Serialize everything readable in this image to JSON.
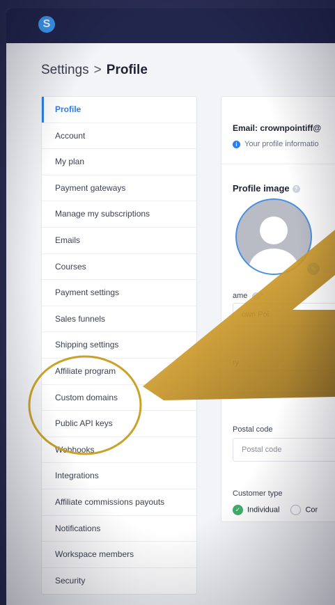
{
  "app": {
    "logo_letter": "S"
  },
  "breadcrumb": {
    "root": "Settings",
    "separator": ">",
    "current": "Profile"
  },
  "sidebar": {
    "items": [
      {
        "label": "Profile",
        "active": true
      },
      {
        "label": "Account"
      },
      {
        "label": "My plan"
      },
      {
        "label": "Payment gateways"
      },
      {
        "label": "Manage my subscriptions"
      },
      {
        "label": "Emails"
      },
      {
        "label": "Courses"
      },
      {
        "label": "Payment settings"
      },
      {
        "label": "Sales funnels"
      },
      {
        "label": "Shipping settings"
      },
      {
        "label": "Affiliate program"
      },
      {
        "label": "Custom domains"
      },
      {
        "label": "Public API keys"
      },
      {
        "label": "Webhooks"
      },
      {
        "label": "Integrations"
      },
      {
        "label": "Affiliate commissions payouts"
      },
      {
        "label": "Notifications"
      },
      {
        "label": "Workspace members"
      },
      {
        "label": "Security"
      }
    ]
  },
  "main": {
    "email_text": "Email: crownpointiff@",
    "info_text": "Your profile informatio",
    "profile_image_label": "Profile image",
    "name_label": "ame",
    "name_value": "own Poi",
    "country_label": "ry",
    "postal_label": "Postal code",
    "postal_placeholder": "Postal code",
    "customer_type_label": "Customer type",
    "customer_type_options": [
      "Individual",
      "Cor"
    ]
  },
  "colors": {
    "accent": "#2d7fe8",
    "topbar": "#22264c",
    "highlight_circle": "#c9a227",
    "arrow_gold": "#d4a934"
  }
}
